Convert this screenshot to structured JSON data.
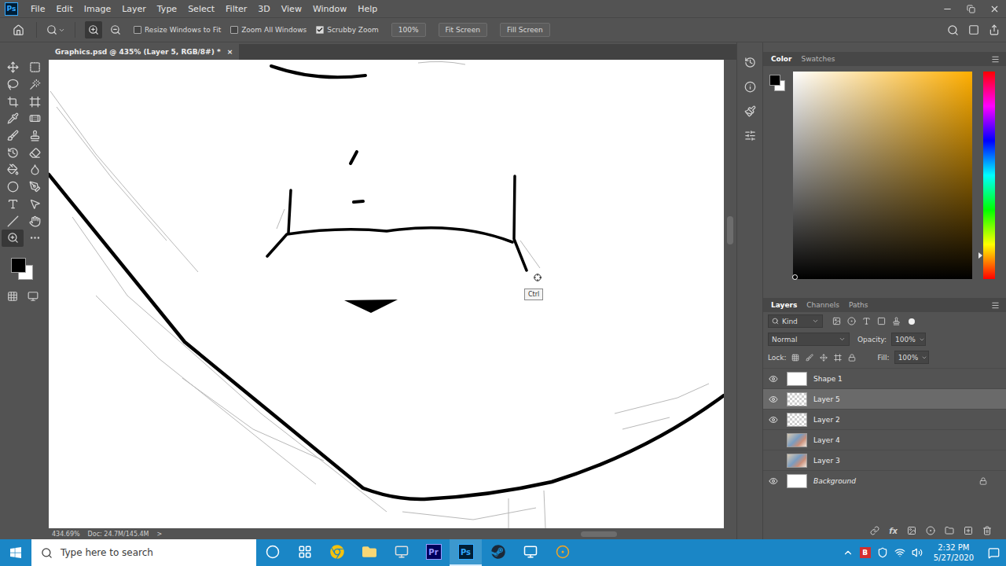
{
  "app": {
    "logo": "Ps"
  },
  "menu": [
    "File",
    "Edit",
    "Image",
    "Layer",
    "Type",
    "Select",
    "Filter",
    "3D",
    "View",
    "Window",
    "Help"
  ],
  "options_bar": {
    "zoom_in_selected": true,
    "zoom_out_selected": false,
    "checkboxes": [
      {
        "label": "Resize Windows to Fit",
        "checked": false
      },
      {
        "label": "Zoom All Windows",
        "checked": false
      },
      {
        "label": "Scrubby Zoom",
        "checked": true
      }
    ],
    "buttons": [
      "100%",
      "Fit Screen",
      "Fill Screen"
    ]
  },
  "document": {
    "tab_title": "Graphics.psd @ 435% (Layer 5, RGB/8#) *",
    "close": "×",
    "zoom": "434.69%",
    "doc_size": "Doc: 24.7M/145.4M",
    "status_arrow": ">"
  },
  "tooltip": "Ctrl",
  "tools": [
    {
      "selected": false
    },
    {
      "selected": false
    },
    {
      "selected": false
    },
    {
      "selected": false
    },
    {
      "selected": false
    },
    {
      "selected": false
    },
    {
      "selected": false
    },
    {
      "selected": false
    },
    {
      "selected": false
    },
    {
      "selected": false
    },
    {
      "selected": false
    },
    {
      "selected": false
    },
    {
      "selected": false
    },
    {
      "selected": false
    },
    {
      "selected": false
    },
    {
      "selected": false
    },
    {
      "selected": false
    },
    {
      "selected": false
    },
    {
      "selected": false
    },
    {
      "selected": false
    },
    {
      "selected": true
    },
    {
      "selected": false
    }
  ],
  "color_panel": {
    "tabs": [
      {
        "label": "Color",
        "selected": true
      },
      {
        "label": "Swatches",
        "selected": false
      }
    ],
    "hue_level": 0.886,
    "picker": {
      "x": 0.01,
      "y": 0.99
    }
  },
  "layers_panel": {
    "tabs": [
      {
        "label": "Layers",
        "selected": true
      },
      {
        "label": "Channels",
        "selected": false
      },
      {
        "label": "Paths",
        "selected": false
      }
    ],
    "filter": "Kind",
    "blend_mode": "Normal",
    "opacity_label": "Opacity:",
    "opacity": "100%",
    "lock_label": "Lock:",
    "fill_label": "Fill:",
    "fill": "100%",
    "footer_fx": "fx",
    "layers": [
      {
        "name": "Shape 1",
        "visible": true,
        "selected": false,
        "locked": false,
        "kind": "white"
      },
      {
        "name": "Layer 5",
        "visible": true,
        "selected": true,
        "locked": false,
        "kind": "transparent"
      },
      {
        "name": "Layer 2",
        "visible": true,
        "selected": false,
        "locked": false,
        "kind": "transparent"
      },
      {
        "name": "Layer 4",
        "visible": false,
        "selected": false,
        "locked": false,
        "kind": "image"
      },
      {
        "name": "Layer 3",
        "visible": false,
        "selected": false,
        "locked": false,
        "kind": "image"
      },
      {
        "name": "Background",
        "visible": true,
        "selected": false,
        "locked": true,
        "kind": "white"
      }
    ]
  },
  "taskbar": {
    "search_placeholder": "Type here to search",
    "apps": [
      {
        "kind": "icon",
        "label": "",
        "active": false,
        "color": "#ffffff"
      },
      {
        "kind": "icon",
        "label": "",
        "active": false,
        "color": "#ffffff"
      },
      {
        "kind": "icon",
        "label": "",
        "active": false,
        "color": "#f4c20d"
      },
      {
        "kind": "icon",
        "label": "",
        "active": false,
        "color": "#f8d775"
      },
      {
        "kind": "icon",
        "label": "",
        "active": false,
        "color": "#dddddd"
      },
      {
        "kind": "tile",
        "label": "Pr",
        "active": false,
        "color": "#9999ff"
      },
      {
        "kind": "tile",
        "label": "Ps",
        "active": true,
        "color": "#31a8ff"
      },
      {
        "kind": "icon",
        "label": "",
        "active": false,
        "color": "#1b2838"
      },
      {
        "kind": "icon",
        "label": "",
        "active": false,
        "color": "#ffffff"
      },
      {
        "kind": "icon",
        "label": "",
        "active": false,
        "color": "#f5a623"
      }
    ],
    "tray_badge": "B",
    "time": "2:32 PM",
    "date": "5/27/2020"
  }
}
